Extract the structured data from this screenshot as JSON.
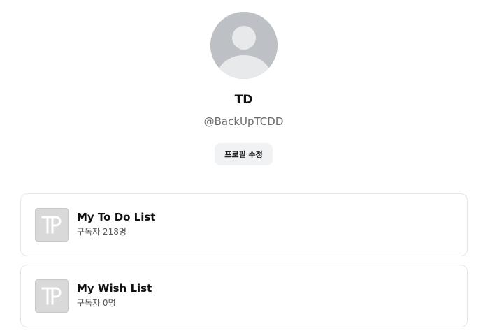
{
  "profile": {
    "avatar_icon": "default-user-avatar-icon",
    "display_name": "TD",
    "handle": "@BackUpTCDD",
    "edit_button_label": "프로필 수정"
  },
  "lists": [
    {
      "thumbnail_icon": "tp-logo-icon",
      "title": "My To Do List",
      "subscribers": "구독자 218명"
    },
    {
      "thumbnail_icon": "tp-logo-icon",
      "title": "My Wish List",
      "subscribers": "구독자 0명"
    }
  ],
  "colors": {
    "avatar_bg": "#bdc1c6",
    "avatar_figure": "#e8e9ea",
    "button_bg": "#f1f2f3",
    "card_border": "#e6e6e6",
    "thumbnail_bg": "#d9d9d9"
  }
}
